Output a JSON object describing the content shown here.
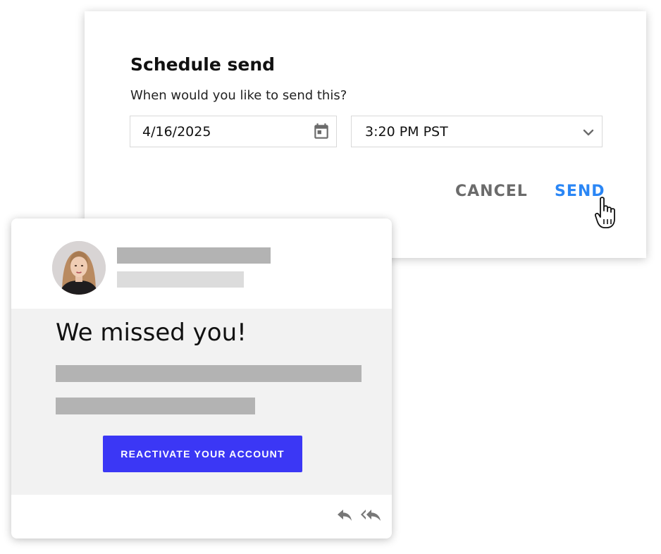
{
  "schedule_dialog": {
    "title": "Schedule send",
    "subtitle": "When would you like to send this?",
    "date_value": "4/16/2025",
    "time_value": "3:20 PM PST",
    "cancel_label": "CANCEL",
    "send_label": "SEND",
    "icons": {
      "date": "calendar-icon",
      "time": "chevron-down-icon",
      "pointer": "hand-pointer-icon"
    },
    "colors": {
      "send": "#2a86f5",
      "cancel": "#6b6b6b"
    }
  },
  "email_card": {
    "heading": "We missed you!",
    "cta_label": "REACTIVATE YOUR ACCOUNT",
    "icons": {
      "avatar": "avatar",
      "reply": "reply-icon",
      "reply_all": "reply-all-icon"
    },
    "colors": {
      "cta": "#3b37f5",
      "body_background": "#f2f2f2",
      "placeholder_dark": "#b3b3b3",
      "placeholder_light": "#dcdcdc"
    }
  }
}
